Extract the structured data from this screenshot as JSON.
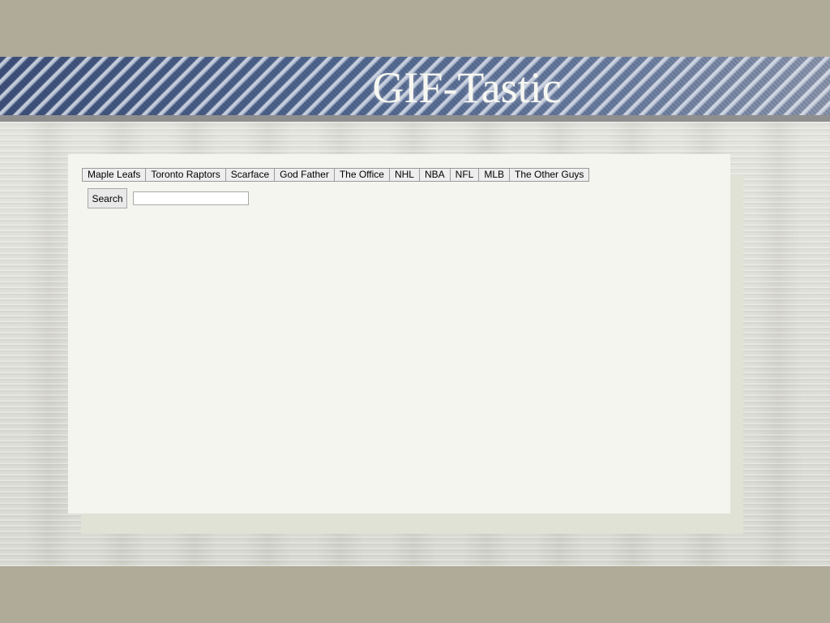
{
  "header": {
    "title": "GIF-Tastic"
  },
  "topics": [
    "Maple Leafs",
    "Toronto Raptors",
    "Scarface",
    "God Father",
    "The Office",
    "NHL",
    "NBA",
    "NFL",
    "MLB",
    "The Other Guys"
  ],
  "search": {
    "button_label": "Search",
    "input_value": "",
    "placeholder": ""
  },
  "colors": {
    "page_background": "#b0aa98",
    "banner_denim": "#4a5e86",
    "panel_background": "#f5f5ef",
    "panel_shadow": "#e1e2d6"
  }
}
